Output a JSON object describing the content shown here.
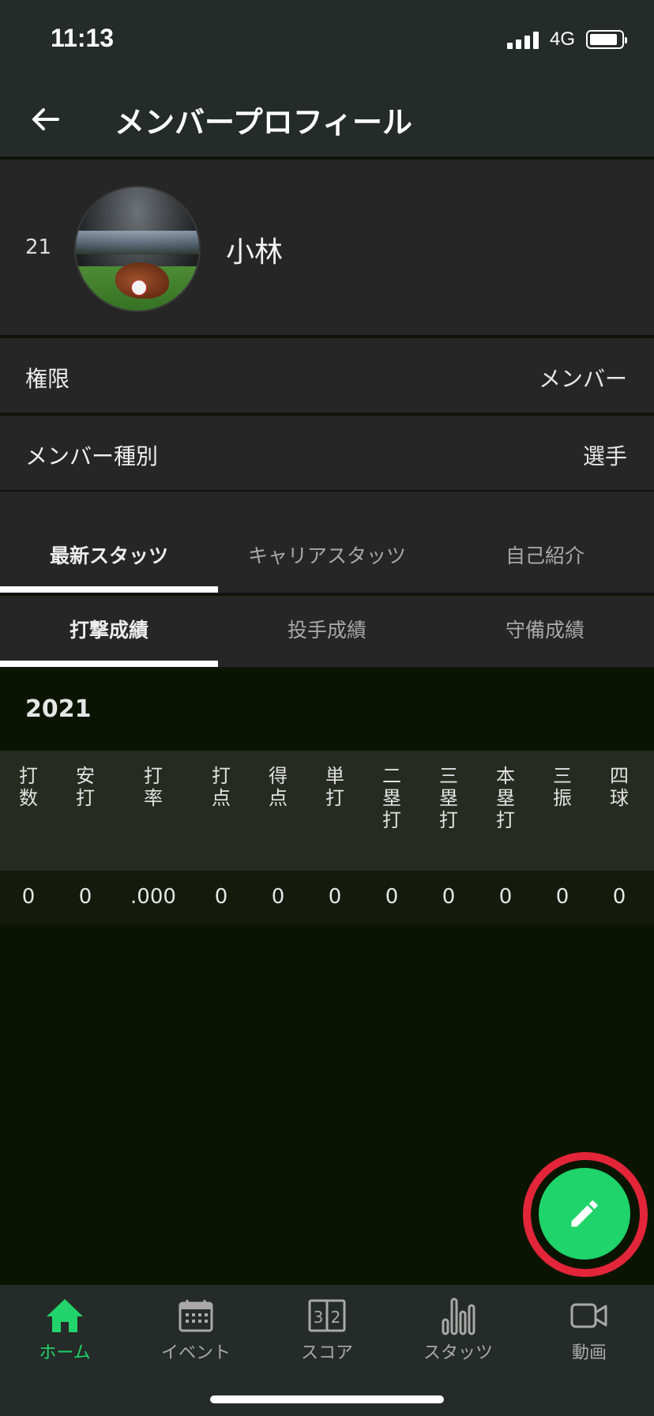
{
  "status_bar": {
    "time": "11:13",
    "network": "4G"
  },
  "app_bar": {
    "title": "メンバープロフィール",
    "back_icon": "arrow-left-icon"
  },
  "profile": {
    "number": "21",
    "name": "小林"
  },
  "info_rows": [
    {
      "label": "権限",
      "value": "メンバー"
    },
    {
      "label": "メンバー種別",
      "value": "選手"
    }
  ],
  "main_tabs": [
    {
      "label": "最新スタッツ",
      "active": true
    },
    {
      "label": "キャリアスタッツ",
      "active": false
    },
    {
      "label": "自己紹介",
      "active": false
    }
  ],
  "sub_tabs": [
    {
      "label": "打撃成績",
      "active": true
    },
    {
      "label": "投手成績",
      "active": false
    },
    {
      "label": "守備成績",
      "active": false
    }
  ],
  "stats": {
    "year": "2021",
    "headers": [
      [
        "打",
        "数"
      ],
      [
        "安",
        "打"
      ],
      [
        "打",
        "率"
      ],
      [
        "打",
        "点"
      ],
      [
        "得",
        "点"
      ],
      [
        "単",
        "打"
      ],
      [
        "二",
        "塁",
        "打"
      ],
      [
        "三",
        "塁",
        "打"
      ],
      [
        "本",
        "塁",
        "打"
      ],
      [
        "三",
        "振"
      ],
      [
        "四",
        "球"
      ]
    ],
    "values": [
      "0",
      "0",
      ".000",
      "0",
      "0",
      "0",
      "0",
      "0",
      "0",
      "0",
      "0"
    ]
  },
  "fab": {
    "icon": "pencil-icon"
  },
  "bottom_nav": [
    {
      "label": "ホーム",
      "icon": "home-icon",
      "active": true
    },
    {
      "label": "イベント",
      "icon": "calendar-icon",
      "active": false
    },
    {
      "label": "スコア",
      "icon": "scoreboard-icon",
      "active": false
    },
    {
      "label": "スタッツ",
      "icon": "bar-chart-icon",
      "active": false
    },
    {
      "label": "動画",
      "icon": "video-camera-icon",
      "active": false
    }
  ],
  "colors": {
    "accent": "#1fd46a",
    "highlight_ring": "#e3253a",
    "background": "#0b1400",
    "panel": "#262626"
  }
}
